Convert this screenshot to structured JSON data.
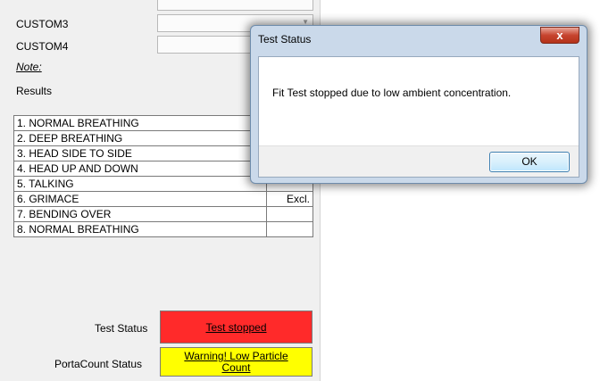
{
  "form": {
    "custom3_label": "CUSTOM3",
    "custom4_label": "CUSTOM4",
    "note_label": "Note:",
    "results_label": "Results",
    "custom3_value": "",
    "custom4_value": ""
  },
  "results": {
    "rows": [
      {
        "exercise": "1. NORMAL BREATHING",
        "value": ""
      },
      {
        "exercise": "2. DEEP BREATHING",
        "value": ""
      },
      {
        "exercise": "3. HEAD SIDE TO SIDE",
        "value": ""
      },
      {
        "exercise": "4. HEAD UP AND DOWN",
        "value": ""
      },
      {
        "exercise": "5. TALKING",
        "value": ""
      },
      {
        "exercise": "6. GRIMACE",
        "value": "Excl."
      },
      {
        "exercise": "7. BENDING OVER",
        "value": ""
      },
      {
        "exercise": "8. NORMAL BREATHING",
        "value": ""
      }
    ]
  },
  "status": {
    "test_status_label": "Test Status",
    "test_status_value": "Test stopped",
    "test_status_color": "#ff2a2a",
    "portacount_label": "PortaCount Status",
    "portacount_line1": "Warning! Low Particle",
    "portacount_line2": "Count",
    "portacount_color": "#ffff00"
  },
  "dialog": {
    "title": "Test Status",
    "close_label": "x",
    "message": "Fit Test stopped due to low ambient concentration.",
    "ok_label": "OK"
  }
}
